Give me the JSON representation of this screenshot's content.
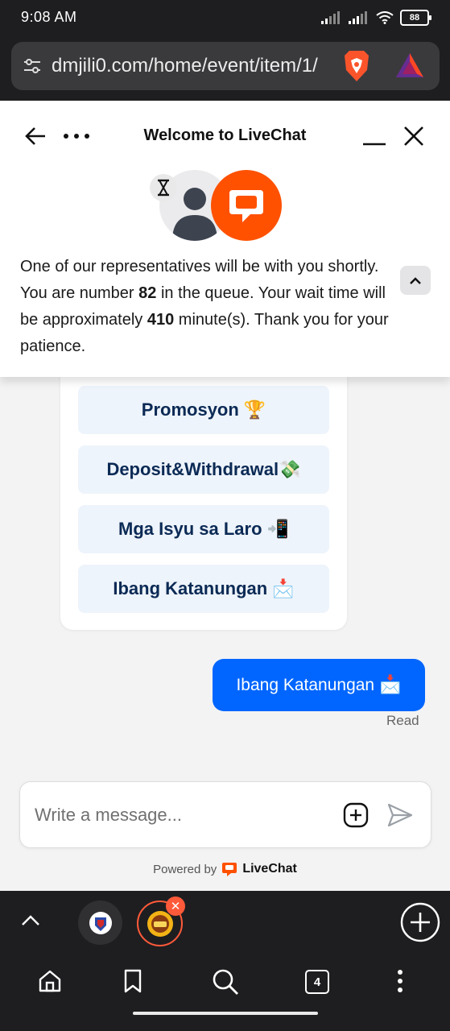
{
  "status_bar": {
    "time": "9:08 AM",
    "battery": "88"
  },
  "browser": {
    "url": "dmjili0.com/home/event/item/1/"
  },
  "chat": {
    "header_title": "Welcome to LiveChat",
    "queue_message": {
      "part1": "One of our representatives will be with you shortly. You are number ",
      "queue_number": "82",
      "part2": " in the queue. Your wait time will be approximately ",
      "wait_minutes": "410",
      "part3": " minute(s). Thank you for your patience."
    },
    "options": [
      {
        "label": "Promosyon",
        "emoji": "🏆"
      },
      {
        "label": "Deposit&Withdrawal",
        "emoji": "💸"
      },
      {
        "label": "Mga Isyu sa Laro",
        "emoji": "📲"
      },
      {
        "label": "Ibang Katanungan",
        "emoji": "📩"
      }
    ],
    "user_message": {
      "text": "Ibang Katanungan",
      "emoji": "📩"
    },
    "read_status": "Read",
    "input_placeholder": "Write a message...",
    "powered_by": "Powered by",
    "brand": "LiveChat"
  },
  "tabs": {
    "open_count": "4"
  },
  "colors": {
    "brand_orange": "#ff5100",
    "user_bubble": "#0066ff",
    "option_text": "#0b2a55",
    "option_bg": "#eef4fb"
  }
}
